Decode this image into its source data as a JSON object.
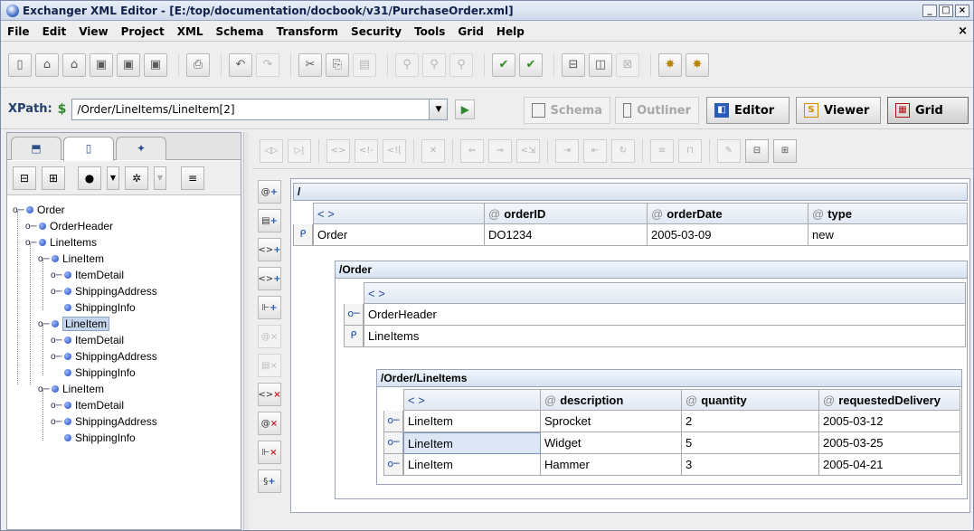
{
  "window": {
    "title": "Exchanger XML Editor - [E:/top/documentation/docbook/v31/PurchaseOrder.xml]",
    "controls": {
      "minimize": "_",
      "maximize": "□",
      "close": "×"
    }
  },
  "menu": {
    "items": [
      "File",
      "Edit",
      "View",
      "Project",
      "XML",
      "Schema",
      "Transform",
      "Security",
      "Tools",
      "Grid",
      "Help"
    ],
    "close_doc": "×"
  },
  "xpath": {
    "label": "XPath:",
    "value": "/Order/LineItems/LineItem[2]"
  },
  "views": {
    "schema": "Schema",
    "outliner": "Outliner",
    "editor": "Editor",
    "viewer": "Viewer",
    "grid": "Grid"
  },
  "tree": {
    "nodes": [
      {
        "label": "Order"
      },
      {
        "label": "OrderHeader"
      },
      {
        "label": "LineItems"
      },
      {
        "label": "LineItem"
      },
      {
        "label": "ItemDetail"
      },
      {
        "label": "ShippingAddress"
      },
      {
        "label": "ShippingInfo"
      },
      {
        "label": "LineItem"
      },
      {
        "label": "ItemDetail"
      },
      {
        "label": "ShippingAddress"
      },
      {
        "label": "ShippingInfo"
      },
      {
        "label": "LineItem"
      },
      {
        "label": "ItemDetail"
      },
      {
        "label": "ShippingAddress"
      },
      {
        "label": "ShippingInfo"
      }
    ],
    "selected_index": 7
  },
  "grid": {
    "root": {
      "path": "/",
      "headers": [
        "< >",
        "orderID",
        "orderDate",
        "type"
      ],
      "row": [
        "Order",
        "DO1234",
        "2005-03-09",
        "new"
      ]
    },
    "order": {
      "path": "/Order",
      "header": "< >",
      "rows": [
        "OrderHeader",
        "LineItems"
      ]
    },
    "lineitems": {
      "path": "/Order/LineItems",
      "headers": [
        "< >",
        "description",
        "quantity",
        "requestedDelivery"
      ],
      "rows": [
        [
          "LineItem",
          "Sprocket",
          "2",
          "2005-03-12"
        ],
        [
          "LineItem",
          "Widget",
          "5",
          "2005-03-25"
        ],
        [
          "LineItem",
          "Hammer",
          "3",
          "2005-04-21"
        ]
      ]
    },
    "attr_marker": "@"
  }
}
